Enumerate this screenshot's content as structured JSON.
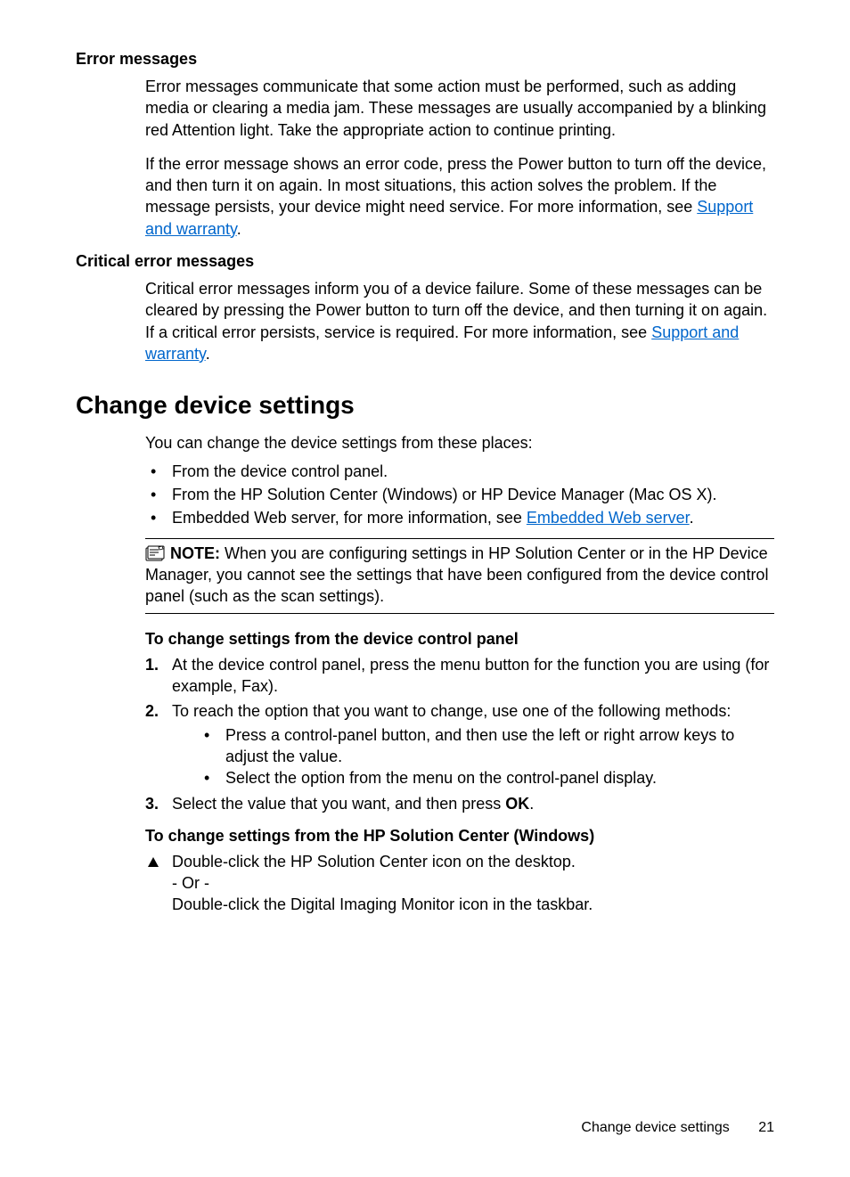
{
  "sections": {
    "error_messages": {
      "heading": "Error messages",
      "p1_a": "Error messages communicate that some action must be performed, such as adding media or clearing a media jam. These messages are usually accompanied by a blinking red Attention light. Take the appropriate action to continue printing.",
      "p2_a": "If the error message shows an error code, press the Power button to turn off the device, and then turn it on again. In most situations, this action solves the problem. If the message persists, your device might need service. For more information, see ",
      "p2_link": "Support and warranty",
      "p2_b": "."
    },
    "critical": {
      "heading": "Critical error messages",
      "p1_a": "Critical error messages inform you of a device failure. Some of these messages can be cleared by pressing the Power button to turn off the device, and then turning it on again. If a critical error persists, service is required. For more information, see ",
      "p1_link": "Support and warranty",
      "p1_b": "."
    },
    "change": {
      "heading": "Change device settings",
      "intro": "You can change the device settings from these places:",
      "b1": "From the device control panel.",
      "b2": "From the HP Solution Center (Windows) or HP Device Manager (Mac OS X).",
      "b3_a": "Embedded Web server, for more information, see ",
      "b3_link": "Embedded Web server",
      "b3_b": ".",
      "note_label": "NOTE:",
      "note_body": " When you are configuring settings in HP Solution Center or in the HP Device Manager, you cannot see the settings that have been configured from the device control panel (such as the scan settings).",
      "sub1": "To change settings from the device control panel",
      "n1": "At the device control panel, press the menu button for the function you are using (for example, Fax).",
      "n2": "To reach the option that you want to change, use one of the following methods:",
      "n2_b1": "Press a control-panel button, and then use the left or right arrow keys to adjust the value.",
      "n2_b2": "Select the option from the menu on the control-panel display.",
      "n3_a": "Select the value that you want, and then press ",
      "n3_ok": "OK",
      "n3_b": ".",
      "sub2": "To change settings from the HP Solution Center (Windows)",
      "t1": "Double-click the HP Solution Center icon on the desktop.",
      "t_or": "- Or -",
      "t2": "Double-click the Digital Imaging Monitor icon in the taskbar."
    }
  },
  "footer": {
    "text": "Change device settings",
    "page": "21"
  }
}
